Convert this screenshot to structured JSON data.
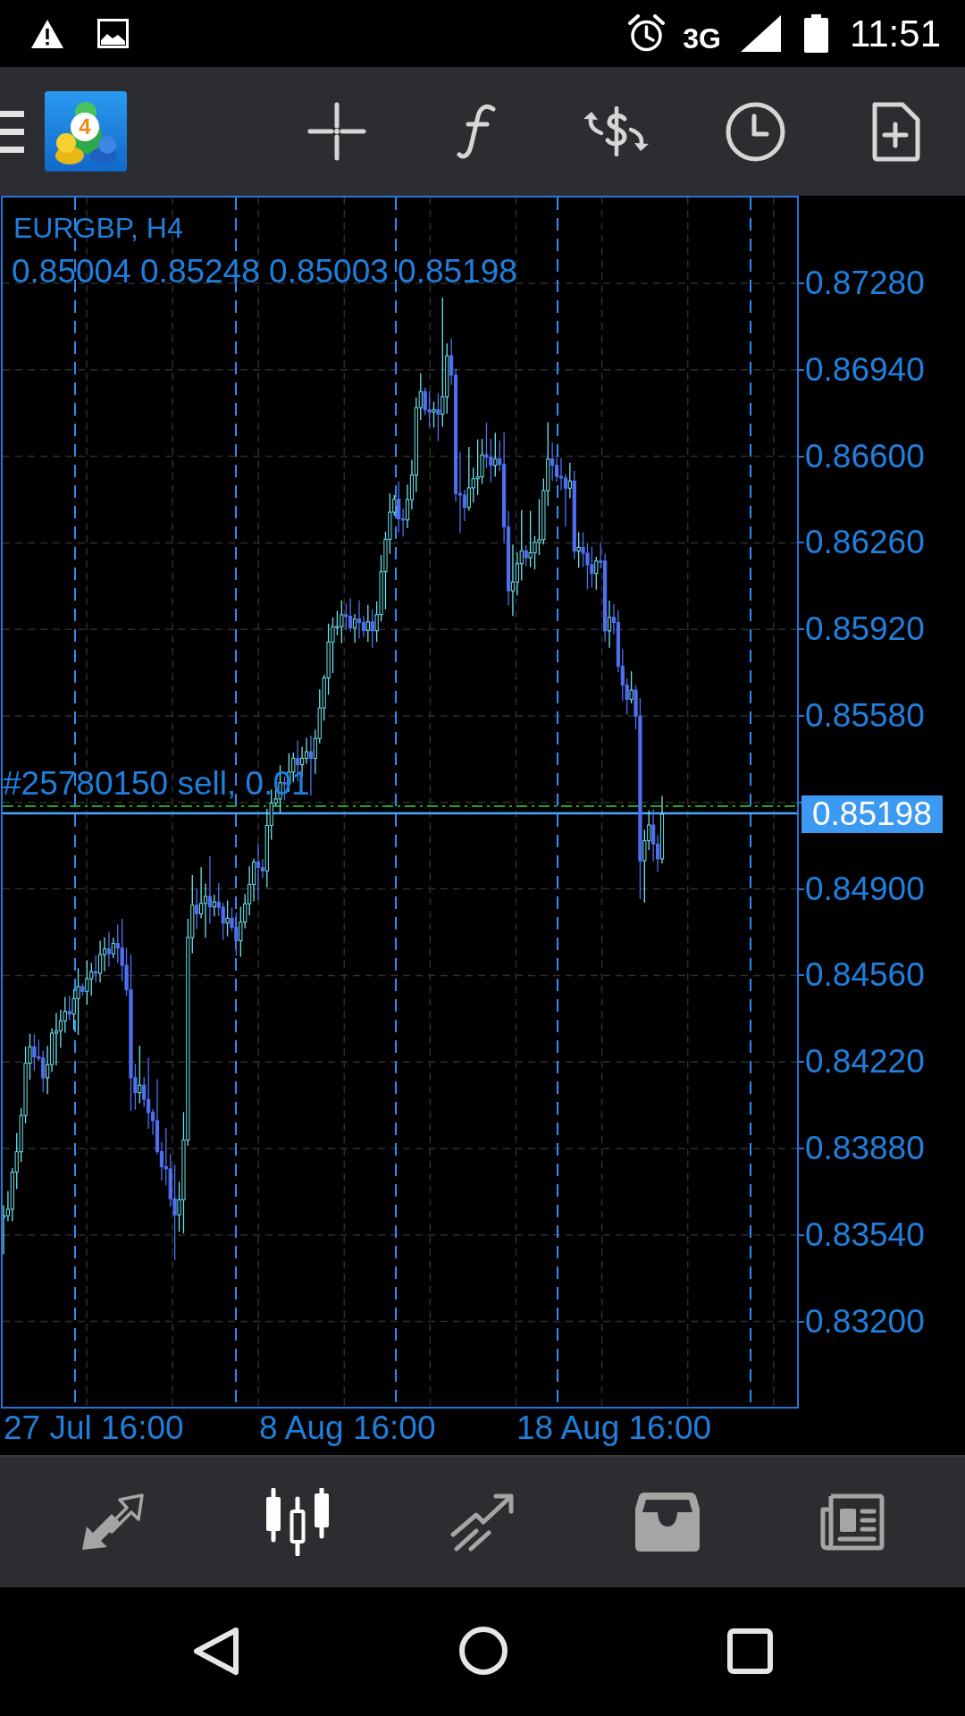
{
  "status_bar": {
    "network": "3G",
    "time": "11:51"
  },
  "toolbar": {
    "logo_badge": "4"
  },
  "chart": {
    "symbol": "EURGBP, H4",
    "ohlc": "0.85004 0.85248 0.85003 0.85198",
    "order_label": "#25780150 sell, 0.01",
    "current_price": "0.85198",
    "price_labels": [
      "0.87280",
      "0.86940",
      "0.86600",
      "0.86260",
      "0.85920",
      "0.85580",
      "0.84900",
      "0.84560",
      "0.84220",
      "0.83880",
      "0.83540",
      "0.83200"
    ],
    "time_labels": [
      "27 Jul 16:00",
      "8 Aug 16:00",
      "18 Aug 16:00"
    ]
  },
  "bottom_nav": [
    {
      "kind": "arrows",
      "selected": false
    },
    {
      "kind": "candles",
      "selected": true
    },
    {
      "kind": "trend",
      "selected": false
    },
    {
      "kind": "tray",
      "selected": false
    },
    {
      "kind": "newspaper",
      "selected": false
    }
  ]
}
